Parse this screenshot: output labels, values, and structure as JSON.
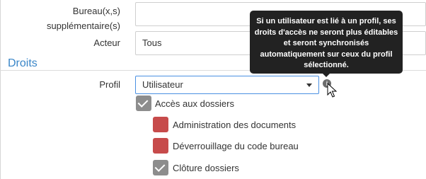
{
  "fields": {
    "bureau_label": "Bureau(x,s) supplémentaire(s)",
    "bureau_value": "",
    "acteur_label": "Acteur",
    "acteur_value": "Tous"
  },
  "droits": {
    "section_title": "Droits",
    "profil_label": "Profil",
    "profil_value": "Utilisateur",
    "info_icon": "info-icon"
  },
  "tooltip": {
    "text": "Si un utilisateur est lié à un profil, ses droits d'accès ne seront plus éditables et seront synchronisés automatiquement sur ceux du profil sélectionné."
  },
  "permissions": [
    {
      "label": "Accès aux dossiers",
      "checked": true
    },
    {
      "label": "Administration des documents",
      "checked": false
    },
    {
      "label": "Déverrouillage du code bureau",
      "checked": false
    },
    {
      "label": "Clôture dossiers",
      "checked": true
    }
  ],
  "colors": {
    "section_title": "#3a86c8",
    "checkbox_checked": "#8d8d8d",
    "checkbox_unchecked": "#c74b4b",
    "tooltip_bg": "#222222",
    "select_border": "#4a90e2"
  }
}
